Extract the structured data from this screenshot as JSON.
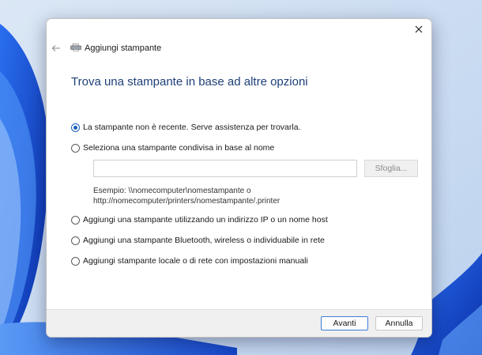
{
  "window": {
    "title": "Aggiungi stampante"
  },
  "page": {
    "heading": "Trova una stampante in base ad altre opzioni"
  },
  "options": [
    {
      "label": "La stampante non è recente. Serve assistenza per trovarla.",
      "checked": true
    },
    {
      "label": "Seleziona una stampante condivisa in base al nome",
      "checked": false
    },
    {
      "label": "Aggiungi una stampante utilizzando un indirizzo IP o un nome host",
      "checked": false
    },
    {
      "label": "Aggiungi una stampante Bluetooth, wireless o individuabile in rete",
      "checked": false
    },
    {
      "label": "Aggiungi stampante locale o di rete con impostazioni manuali",
      "checked": false
    }
  ],
  "shared_printer": {
    "input_value": "",
    "browse_label": "Sfoglia...",
    "example_line1": "Esempio: \\\\nomecomputer\\nomestampante o",
    "example_line2": "http://nomecomputer/printers/nomestampante/.printer"
  },
  "footer": {
    "next_label": "Avanti",
    "cancel_label": "Annulla"
  },
  "icons": {
    "close": "close-icon",
    "back": "back-arrow-icon",
    "printer": "printer-icon"
  },
  "colors": {
    "heading": "#1e3f78",
    "accent": "#1a5fbf",
    "wallpaper": "#1f4fd1"
  }
}
